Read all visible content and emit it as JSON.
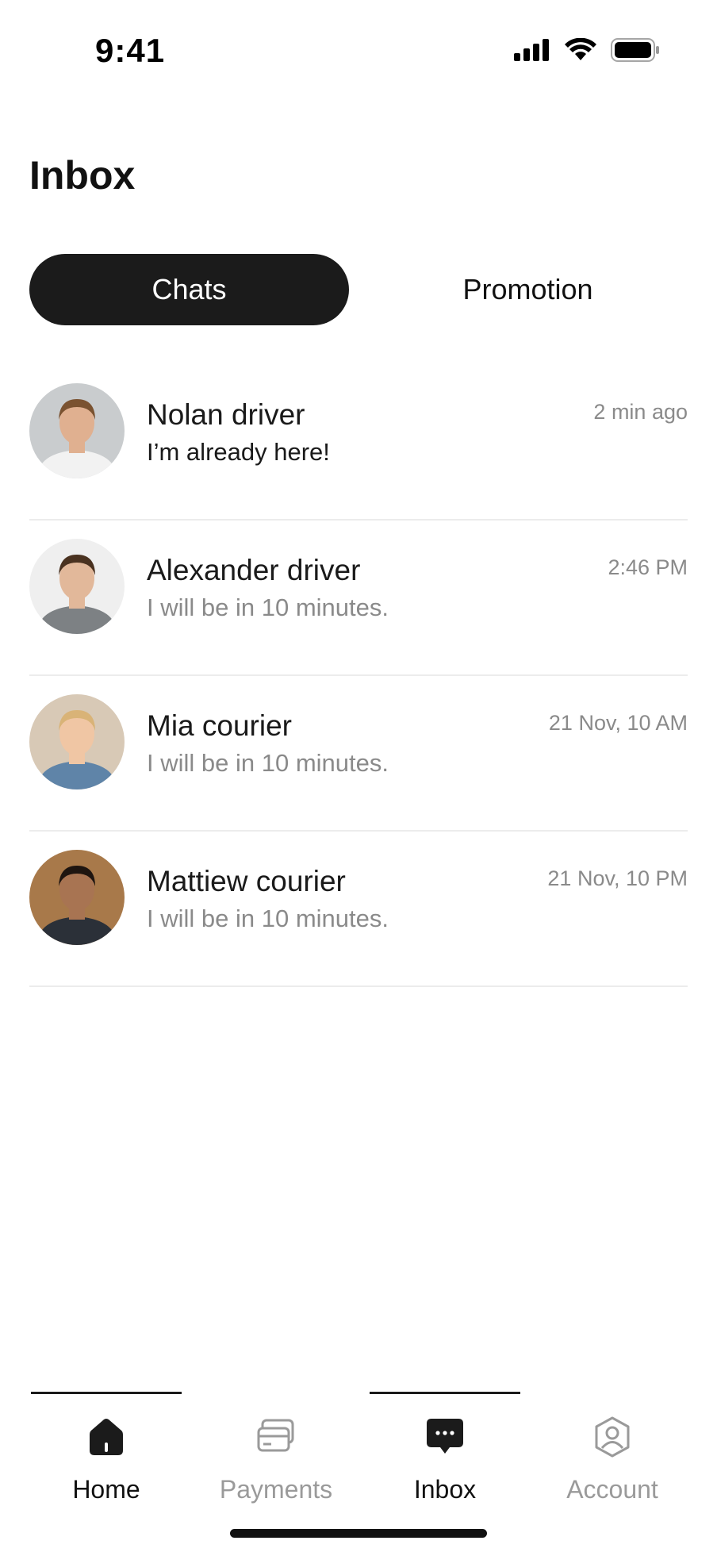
{
  "status_bar": {
    "time": "9:41"
  },
  "page": {
    "title": "Inbox"
  },
  "segments": {
    "chats": "Chats",
    "promotion": "Promotion",
    "selected": "Chats"
  },
  "chats": [
    {
      "name": "Nolan driver",
      "message": "I’m already here!",
      "time": "2 min ago",
      "unread": true,
      "avatar": {
        "bg": "#c9ccce",
        "skin": "#e0b090",
        "hair": "#7a5230",
        "shirt": "#f2f2f2"
      }
    },
    {
      "name": "Alexander driver",
      "message": "I will be in 10 minutes.",
      "time": "2:46 PM",
      "unread": false,
      "avatar": {
        "bg": "#efefef",
        "skin": "#e2b89a",
        "hair": "#4a3220",
        "shirt": "#7d8184"
      }
    },
    {
      "name": "Mia courier",
      "message": "I will be in 10 minutes.",
      "time": "21 Nov, 10 AM",
      "unread": false,
      "avatar": {
        "bg": "#d8c9b6",
        "skin": "#f0c6a4",
        "hair": "#d9b377",
        "shirt": "#5f84a8"
      }
    },
    {
      "name": "Mattiew courier",
      "message": "I will be in 10 minutes.",
      "time": "21 Nov, 10 PM",
      "unread": false,
      "avatar": {
        "bg": "#a8794a",
        "skin": "#a87452",
        "hair": "#1e1510",
        "shirt": "#2b3038"
      }
    }
  ],
  "tab_bar": {
    "items": [
      {
        "label": "Home",
        "icon": "home-icon",
        "active": true
      },
      {
        "label": "Payments",
        "icon": "payments-icon",
        "active": false
      },
      {
        "label": "Inbox",
        "icon": "inbox-icon",
        "active": true
      },
      {
        "label": "Account",
        "icon": "account-icon",
        "active": false
      }
    ]
  },
  "colors": {
    "primary": "#1b1b1b",
    "muted": "#8a8a8a",
    "divider": "#ececec"
  }
}
